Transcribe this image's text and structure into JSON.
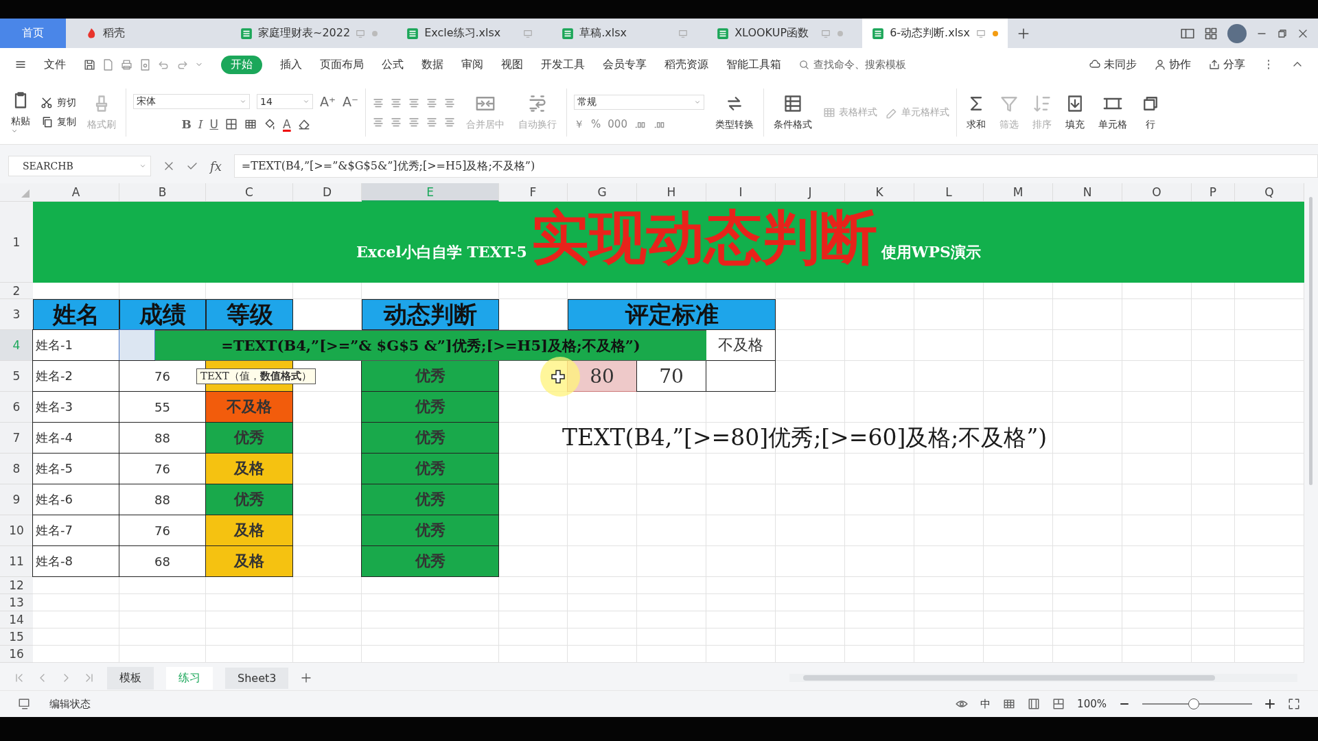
{
  "tabs": [
    {
      "label": "首页",
      "kind": "home",
      "selected": false
    },
    {
      "label": "稻壳",
      "kind": "docer",
      "selected": false
    },
    {
      "label": "家庭理财表~2022",
      "kind": "sheet",
      "selected": false,
      "dot": true
    },
    {
      "label": "Excle练习.xlsx",
      "kind": "sheet",
      "selected": false,
      "dot": false
    },
    {
      "label": "草稿.xlsx",
      "kind": "sheet",
      "selected": false,
      "dot": false
    },
    {
      "label": "XLOOKUP函数",
      "kind": "sheet",
      "selected": false,
      "dot": true
    },
    {
      "label": "6-动态判断.xlsx",
      "kind": "sheet",
      "selected": true,
      "dot": true
    }
  ],
  "menu": {
    "file": "文件",
    "tabs": [
      {
        "label": "开始",
        "selected": true
      },
      {
        "label": "插入",
        "selected": false
      },
      {
        "label": "页面布局",
        "selected": false
      },
      {
        "label": "公式",
        "selected": false
      },
      {
        "label": "数据",
        "selected": false
      },
      {
        "label": "审阅",
        "selected": false
      },
      {
        "label": "视图",
        "selected": false
      },
      {
        "label": "开发工具",
        "selected": false
      },
      {
        "label": "会员专享",
        "selected": false
      },
      {
        "label": "稻壳资源",
        "selected": false
      },
      {
        "label": "智能工具箱",
        "selected": false
      }
    ],
    "search": {
      "placeholder": "查找命令、搜索模板"
    },
    "actions": [
      "未同步",
      "协作",
      "分享"
    ]
  },
  "ribbon": {
    "clipboard": {
      "paste": "粘贴",
      "cut": "剪切",
      "copy": "复制",
      "format_painter": {
        "label": "格式刷",
        "disabled": true
      }
    },
    "font": {
      "name": "宋体",
      "size": "14",
      "size_buttons": [
        "A⁺",
        "A⁻"
      ],
      "styles": [
        "B",
        "I",
        "U"
      ],
      "font_color": "A"
    },
    "alignment": {
      "merge": "合并居中",
      "wrap": "自动换行"
    },
    "number": {
      "format": "常规",
      "symbols": [
        "￥",
        "%",
        "000"
      ],
      "convert": "类型转换"
    },
    "styles": [
      {
        "label": "条件格式",
        "disabled": false
      },
      {
        "label": "表格样式",
        "disabled": true
      },
      {
        "label": "单元格样式",
        "disabled": true
      }
    ],
    "editing": [
      {
        "label": "求和",
        "disabled": false
      },
      {
        "label": "筛选",
        "disabled": true
      },
      {
        "label": "排序",
        "disabled": true
      },
      {
        "label": "填充",
        "disabled": false
      },
      {
        "label": "单元格",
        "disabled": false
      },
      {
        "label": "行",
        "disabled": false
      }
    ]
  },
  "formula_bar": {
    "name_box": "SEARCHB",
    "fx": "fx",
    "formula": "=TEXT(B4,”[>=”&$G$5&”]优秀;[>=H5]及格;不及格”)"
  },
  "sheet": {
    "columns": [
      {
        "label": "A",
        "selected": false
      },
      {
        "label": "B",
        "selected": false
      },
      {
        "label": "C",
        "selected": false
      },
      {
        "label": "D",
        "selected": false
      },
      {
        "label": "E",
        "selected": true
      },
      {
        "label": "F",
        "selected": false
      },
      {
        "label": "G",
        "selected": false
      },
      {
        "label": "H",
        "selected": false
      },
      {
        "label": "I",
        "selected": false
      },
      {
        "label": "J",
        "selected": false
      },
      {
        "label": "K",
        "selected": false
      },
      {
        "label": "L",
        "selected": false
      },
      {
        "label": "M",
        "selected": false
      },
      {
        "label": "N",
        "selected": false
      },
      {
        "label": "O",
        "selected": false
      },
      {
        "label": "P",
        "selected": false
      },
      {
        "label": "Q",
        "selected": false
      }
    ],
    "rows": [
      {
        "label": "1",
        "selected": false
      },
      {
        "label": "2",
        "selected": false
      },
      {
        "label": "3",
        "selected": false
      },
      {
        "label": "4",
        "selected": true
      },
      {
        "label": "5",
        "selected": false
      },
      {
        "label": "6",
        "selected": false
      },
      {
        "label": "7",
        "selected": false
      },
      {
        "label": "8",
        "selected": false
      },
      {
        "label": "9",
        "selected": false
      },
      {
        "label": "10",
        "selected": false
      },
      {
        "label": "11",
        "selected": false
      },
      {
        "label": "12",
        "selected": false
      },
      {
        "label": "13",
        "selected": false
      },
      {
        "label": "14",
        "selected": false
      },
      {
        "label": "15",
        "selected": false
      },
      {
        "label": "16",
        "selected": false
      }
    ],
    "title": {
      "subtitle": "Excel小白自学 TEXT-5",
      "heading": "实现动态判断",
      "note": "使用WPS演示"
    },
    "headers": [
      "姓名",
      "成绩",
      "等级"
    ],
    "dynamic_header": "动态判断",
    "criteria_header": "评定标准",
    "students": [
      {
        "name": "姓名-1",
        "selected": true
      },
      {
        "name": "姓名-2",
        "score": "76",
        "selected": false,
        "grade": {
          "color": "#f5c211"
        },
        "dynamic": "优秀"
      },
      {
        "name": "姓名-3",
        "score": "55",
        "selected": false,
        "grade": {
          "text": "不及格",
          "color": "#f25c0c"
        },
        "dynamic": "优秀"
      },
      {
        "name": "姓名-4",
        "score": "88",
        "selected": false,
        "grade": {
          "text": "优秀",
          "color": "#19a94b"
        },
        "dynamic": "优秀"
      },
      {
        "name": "姓名-5",
        "score": "76",
        "selected": false,
        "grade": {
          "text": "及格",
          "color": "#f5c211"
        },
        "dynamic": "优秀"
      },
      {
        "name": "姓名-6",
        "score": "88",
        "selected": false,
        "grade": {
          "text": "优秀",
          "color": "#19a94b"
        },
        "dynamic": "优秀"
      },
      {
        "name": "姓名-7",
        "score": "76",
        "selected": false,
        "grade": {
          "text": "及格",
          "color": "#f5c211"
        },
        "dynamic": "优秀"
      },
      {
        "name": "姓名-8",
        "score": "68",
        "selected": false,
        "grade": {
          "text": "及格",
          "color": "#f5c211"
        },
        "dynamic": "优秀"
      }
    ],
    "criteria": {
      "result": "不及格",
      "thresholds": [
        {
          "text": "80",
          "selected": true
        },
        {
          "text": "70",
          "selected": false
        }
      ]
    },
    "cell_editor": "=TEXT(B4,”[>=”& $G$5 &”]优秀;[>=H5]及格;不及格”)",
    "tooltip": "TEXT（值，**数值格式**）",
    "formula_note": "TEXT(B4,”[>=80]优秀;[>=60]及格;不及格”)"
  },
  "sheet_tabs": [
    {
      "label": "模板",
      "selected": false
    },
    {
      "label": "练习",
      "selected": true
    },
    {
      "label": "Sheet3",
      "selected": false
    }
  ],
  "status_bar": {
    "mode": "编辑状态",
    "input_mode": "中",
    "zoom": "100%",
    "zoom_slider": {
      "level": 0.47
    }
  }
}
